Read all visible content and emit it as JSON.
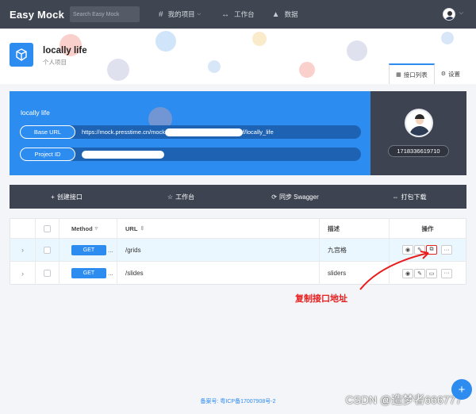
{
  "nav": {
    "brand": "Easy Mock",
    "search_placeholder": "Search Easy Mock",
    "links": [
      {
        "label": "我的项目",
        "icon": "hash-icon"
      },
      {
        "label": "工作台",
        "icon": "arrows-icon"
      },
      {
        "label": "数据",
        "icon": "chart-icon"
      }
    ]
  },
  "project": {
    "name": "locally life",
    "subtitle": "个人项目",
    "tabs": [
      {
        "label": "接口列表",
        "active": true
      },
      {
        "label": "设置",
        "active": false
      }
    ]
  },
  "info": {
    "title": "locally life",
    "base_url_label": "Base URL",
    "base_url_prefix": "https://mock.presstime.cn/mock",
    "base_url_suffix": "f/locally_life",
    "project_id_label": "Project ID",
    "user_id": "1718336619710"
  },
  "toolbar": [
    {
      "label": "创建接口",
      "icon": "plus-icon"
    },
    {
      "label": "工作台",
      "icon": "star-icon"
    },
    {
      "label": "同步 Swagger",
      "icon": "sync-icon"
    },
    {
      "label": "打包下载",
      "icon": "download-icon"
    }
  ],
  "table": {
    "headers": {
      "method": "Method",
      "url": "URL",
      "desc": "描述",
      "ops": "操作"
    },
    "rows": [
      {
        "method": "GET",
        "url": "/grids",
        "desc": "九宫格"
      },
      {
        "method": "GET",
        "url": "/slides",
        "desc": "sliders"
      }
    ]
  },
  "annotation": "复制接口地址",
  "footer": "备案号: 粤ICP备17007908号-2",
  "watermark": "CSDN @造梦者666777",
  "colors": {
    "accent": "#2d8cf0",
    "nav": "#3f4551",
    "card_dark": "#3d4350",
    "annotation": "#e81d1d"
  }
}
